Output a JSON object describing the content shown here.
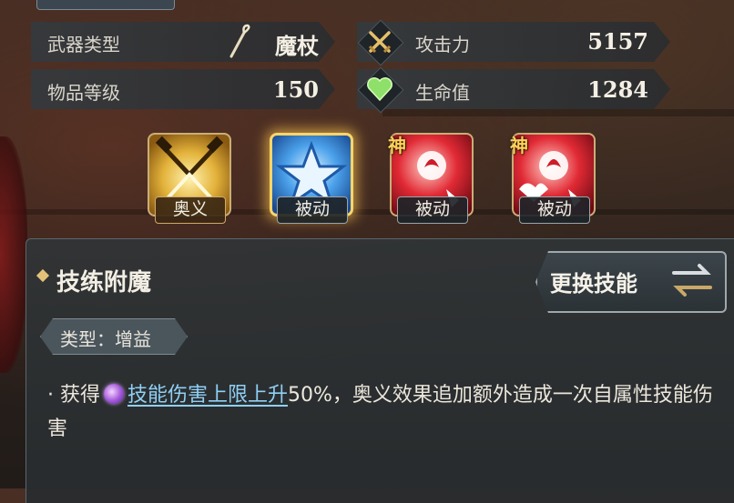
{
  "stats": {
    "weapon_type_label": "武器类型",
    "weapon_type_value": "魔杖",
    "item_level_label": "物品等级",
    "item_level_value": "150",
    "attack_label": "攻击力",
    "attack_value": "5157",
    "hp_label": "生命值",
    "hp_value": "1284"
  },
  "skills": [
    {
      "tag": "奥义",
      "god_badge": "",
      "theme": "gold",
      "icon": "crossed-hammers-icon"
    },
    {
      "tag": "被动",
      "god_badge": "",
      "theme": "blue",
      "icon": "star-icon",
      "selected": true
    },
    {
      "tag": "被动",
      "god_badge": "神",
      "theme": "red",
      "icon": "flame-fist-icon"
    },
    {
      "tag": "被动",
      "god_badge": "神",
      "theme": "red",
      "icon": "flame-fist-icon"
    }
  ],
  "detail": {
    "title": "技练附魔",
    "swap_button": "更换技能",
    "type_label": "类型：增益",
    "desc_prefix": "· 获得",
    "desc_link": "技能伤害上限上升",
    "desc_suffix": "50%，奥义效果追加额外造成一次自属性技能伤害"
  },
  "colors": {
    "accent_gold": "#ffd56a",
    "link_blue": "#8fd0f5",
    "red_skill": "#d01c2a",
    "blue_skill": "#2e7fd8"
  }
}
